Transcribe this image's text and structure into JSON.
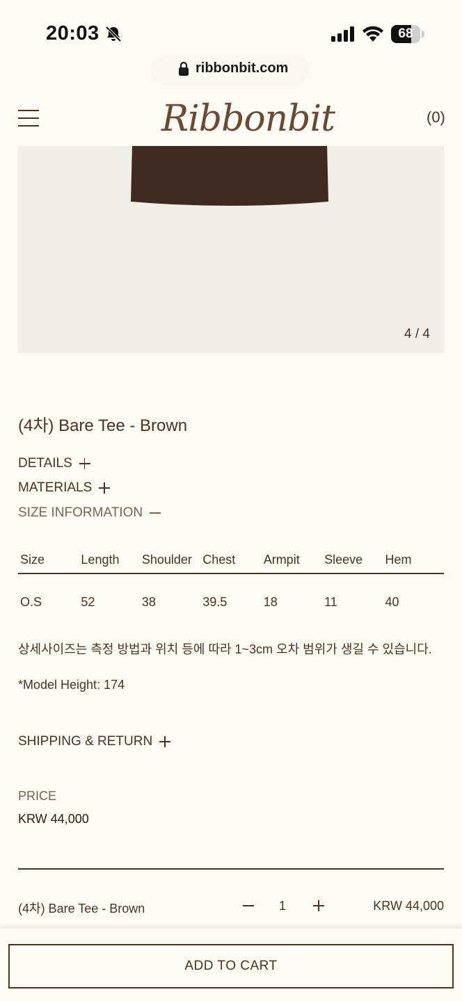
{
  "status_bar": {
    "time": "20:03",
    "battery": "68",
    "battery_level": 0.68
  },
  "browser": {
    "url": "ribbonbit.com"
  },
  "header": {
    "logo": "Ribbonbit",
    "cart_count": "(0)"
  },
  "gallery": {
    "counter": "4 / 4"
  },
  "product": {
    "title": "(4차) Bare Tee - Brown",
    "sections": {
      "details": "DETAILS",
      "materials": "MATERIALS",
      "size_information": "SIZE INFORMATION",
      "shipping_return": "SHIPPING & RETURN"
    },
    "size_table": {
      "headers": [
        "Size",
        "Length",
        "Shoulder",
        "Chest",
        "Armpit",
        "Sleeve",
        "Hem"
      ],
      "rows": [
        [
          "O.S",
          "52",
          "38",
          "39.5",
          "18",
          "11",
          "40"
        ]
      ]
    },
    "size_note": "상세사이즈는 측정 방법과 위치 등에 따라 1~3cm 오차 범위가 생길 수 있습니다.",
    "model_height": "*Model Height: 174",
    "price_label": "PRICE",
    "price": "KRW 44,000"
  },
  "order": {
    "item_name": "(4차) Bare Tee - Brown",
    "quantity": "1",
    "total": "KRW 44,000"
  },
  "cta": {
    "add_to_cart": "ADD TO CART"
  },
  "colors": {
    "background": "#fcfbf3",
    "text_brown": "#4a3322",
    "shirt_brown": "#3e2a1f",
    "image_bg": "#efeee8"
  }
}
